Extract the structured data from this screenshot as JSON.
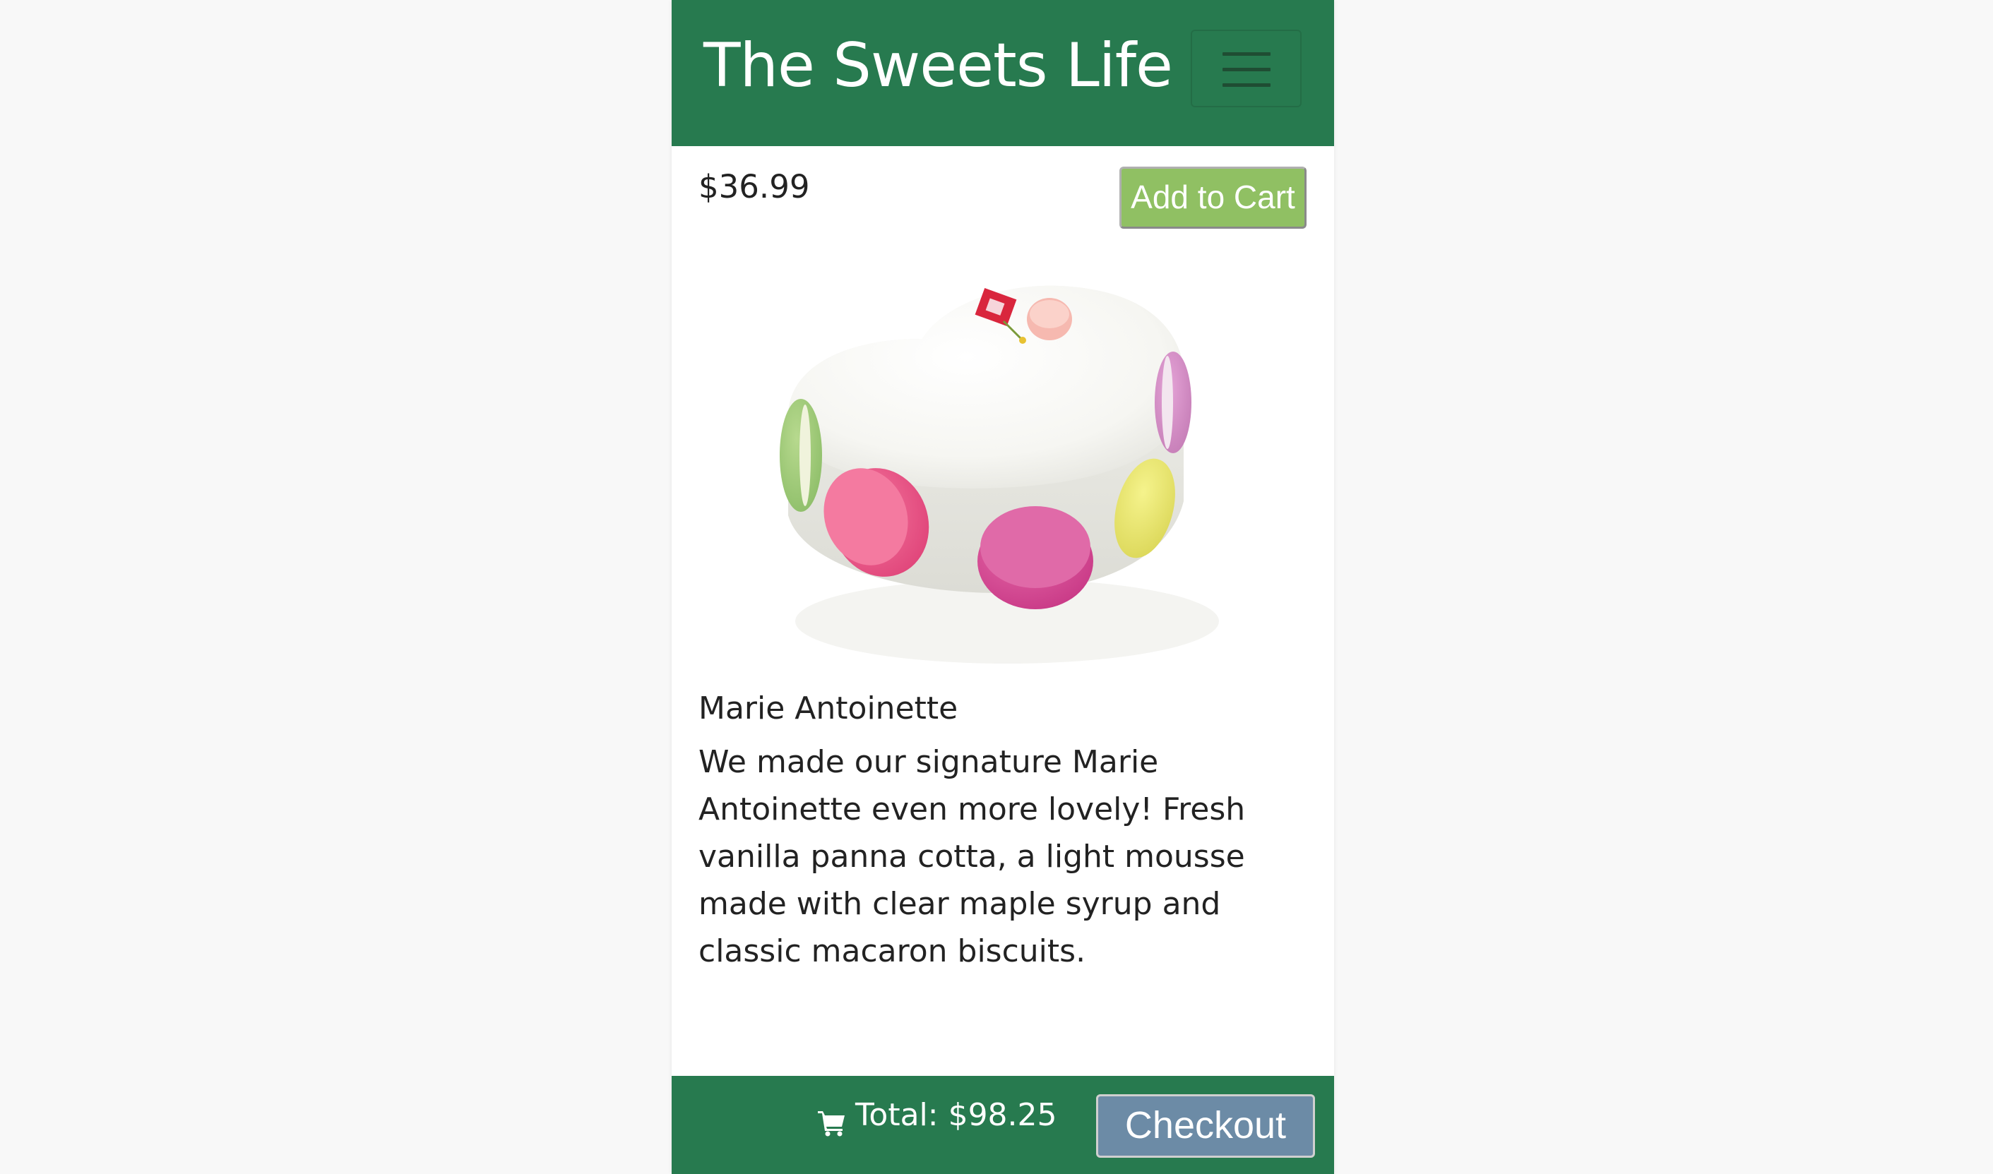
{
  "header": {
    "brand": "The Sweets Life",
    "menu_icon": "hamburger-menu-icon",
    "background": "#277a4f"
  },
  "product": {
    "price": "$36.99",
    "add_to_cart_label": "Add to Cart",
    "image_subject": "heart-shaped white cake with macarons",
    "name": "Marie Antoinette",
    "description": "We made our signature Marie Antoinette even more lovely! Fresh vanilla panna cotta, a light mousse made with clear maple syrup and classic macaron biscuits."
  },
  "footer": {
    "cart_icon": "shopping-cart-icon",
    "total_label": "Total: $98.25",
    "checkout_label": "Checkout",
    "background": "#277a4f"
  },
  "colors": {
    "brand_green": "#277a4f",
    "add_to_cart": "#90c063",
    "checkout": "#6c8ba6"
  }
}
